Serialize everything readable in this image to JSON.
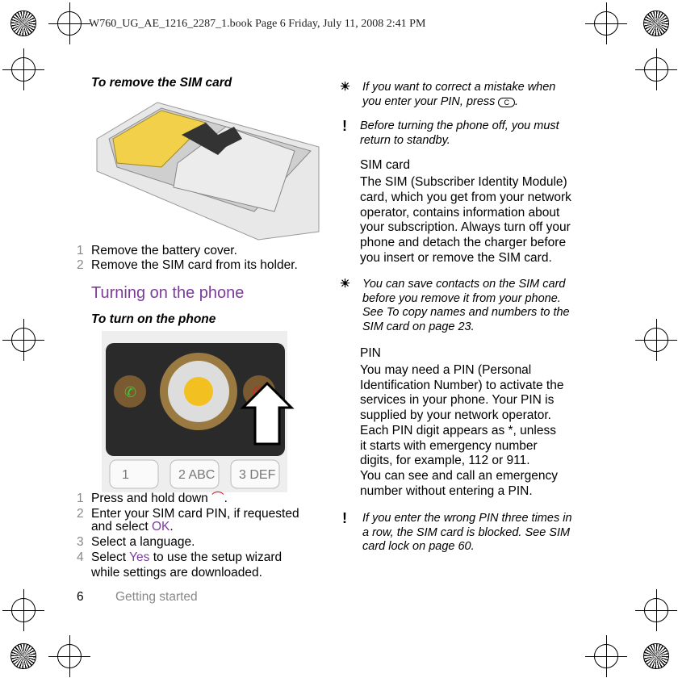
{
  "print_header": "W760_UG_AE_1216_2287_1.book  Page 6  Friday, July 11, 2008  2:41 PM",
  "left": {
    "remove_sim_title": "To remove the SIM card",
    "remove_steps": [
      {
        "n": "1",
        "text": "Remove the battery cover."
      },
      {
        "n": "2",
        "text": "Remove the SIM card from its holder."
      }
    ],
    "section_title": "Turning on the phone",
    "turn_on_title": "To turn on the phone",
    "turn_on_steps": [
      {
        "n": "1",
        "text": "Press and hold down",
        "after": "."
      },
      {
        "n": "2",
        "line1": "Enter your SIM card PIN, if requested",
        "line2a": "and select ",
        "link": "OK",
        "line2b": "."
      },
      {
        "n": "3",
        "text": "Select a language."
      },
      {
        "n": "4",
        "line1a": "Select ",
        "link": "Yes",
        "line1b": " to use the setup wizard",
        "line2": "while settings are downloaded."
      }
    ]
  },
  "right": {
    "tip1": [
      "If you want to correct a mistake when",
      "you enter your PIN, press"
    ],
    "tip1_key": "C",
    "note1": [
      "Before turning the phone off, you must",
      "return to standby."
    ],
    "sim_heading": "SIM card",
    "sim_body": [
      "The SIM (Subscriber Identity Module)",
      "card, which you get from your network",
      "operator, contains information about",
      "your subscription. Always turn off your",
      "phone and detach the charger before",
      "you insert or remove the SIM card."
    ],
    "tip2": [
      "You can save contacts on the SIM card",
      "before you remove it from your phone.",
      "See To copy names and numbers to the",
      "SIM card on page 23."
    ],
    "pin_heading": "PIN",
    "pin_body": [
      "You may need a PIN (Personal",
      "Identification Number) to activate the",
      "services in your phone. Your PIN is",
      "supplied by your network operator.",
      "Each PIN digit appears as *, unless",
      "it starts with emergency number",
      "digits, for example, 112 or 911.",
      "You can see and call an emergency",
      "number without entering a PIN."
    ],
    "note2": [
      "If you enter the wrong PIN three times in",
      "a row, the SIM card is blocked. See SIM",
      "card lock on page 60."
    ]
  },
  "footer": {
    "page_number": "6",
    "section": "Getting started"
  },
  "keypad_labels": [
    "1",
    "2 ABC",
    "3 DEF"
  ],
  "colors": {
    "accent": "#7b3c9a",
    "sim_yellow": "#f2d04a",
    "end_key": "#e02020"
  }
}
